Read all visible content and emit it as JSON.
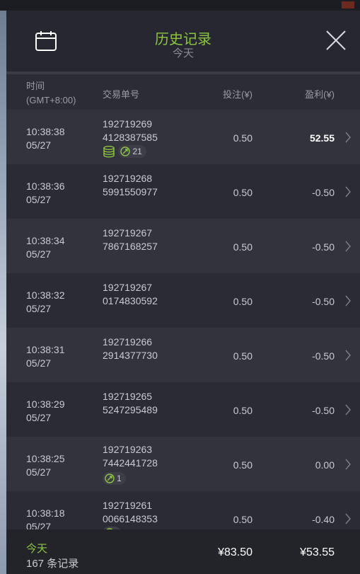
{
  "header": {
    "title": "历史记录",
    "subtitle": "今天"
  },
  "columns": {
    "time_line1": "时间",
    "time_line2": "(GMT+8:00)",
    "order": "交易单号",
    "stake": "投注(¥)",
    "profit": "盈利(¥)"
  },
  "rows": [
    {
      "time": "10:38:38",
      "date": "05/27",
      "order1": "192719269",
      "order2": "4128387585",
      "stake": "0.50",
      "profit": "52.55",
      "coins": true,
      "badge": "21"
    },
    {
      "time": "10:38:36",
      "date": "05/27",
      "order1": "192719268",
      "order2": "5991550977",
      "stake": "0.50",
      "profit": "-0.50"
    },
    {
      "time": "10:38:34",
      "date": "05/27",
      "order1": "192719267",
      "order2": "7867168257",
      "stake": "0.50",
      "profit": "-0.50"
    },
    {
      "time": "10:38:32",
      "date": "05/27",
      "order1": "192719267",
      "order2": "0174830592",
      "stake": "0.50",
      "profit": "-0.50"
    },
    {
      "time": "10:38:31",
      "date": "05/27",
      "order1": "192719266",
      "order2": "2914377730",
      "stake": "0.50",
      "profit": "-0.50"
    },
    {
      "time": "10:38:29",
      "date": "05/27",
      "order1": "192719265",
      "order2": "5247295489",
      "stake": "0.50",
      "profit": "-0.50"
    },
    {
      "time": "10:38:25",
      "date": "05/27",
      "order1": "192719263",
      "order2": "7442441728",
      "stake": "0.50",
      "profit": "0.00",
      "badge": "1"
    },
    {
      "time": "10:38:18",
      "date": "05/27",
      "order1": "192719261",
      "order2": "0066148353",
      "stake": "0.50",
      "profit": "-0.40",
      "badge": ""
    }
  ],
  "footer": {
    "label": "今天",
    "count": "167 条记录",
    "stake_total": "¥83.50",
    "profit_total": "¥53.55"
  },
  "colors": {
    "accent": "#8dc63f",
    "bg": "#2b2c35",
    "header_bg": "#262730",
    "footer_bg": "#232429"
  },
  "icons": {
    "calendar": "calendar-icon",
    "close": "close-icon",
    "chevron": "chevron-right-icon",
    "coins": "coins-icon",
    "free_spin": "free-spin-icon"
  }
}
